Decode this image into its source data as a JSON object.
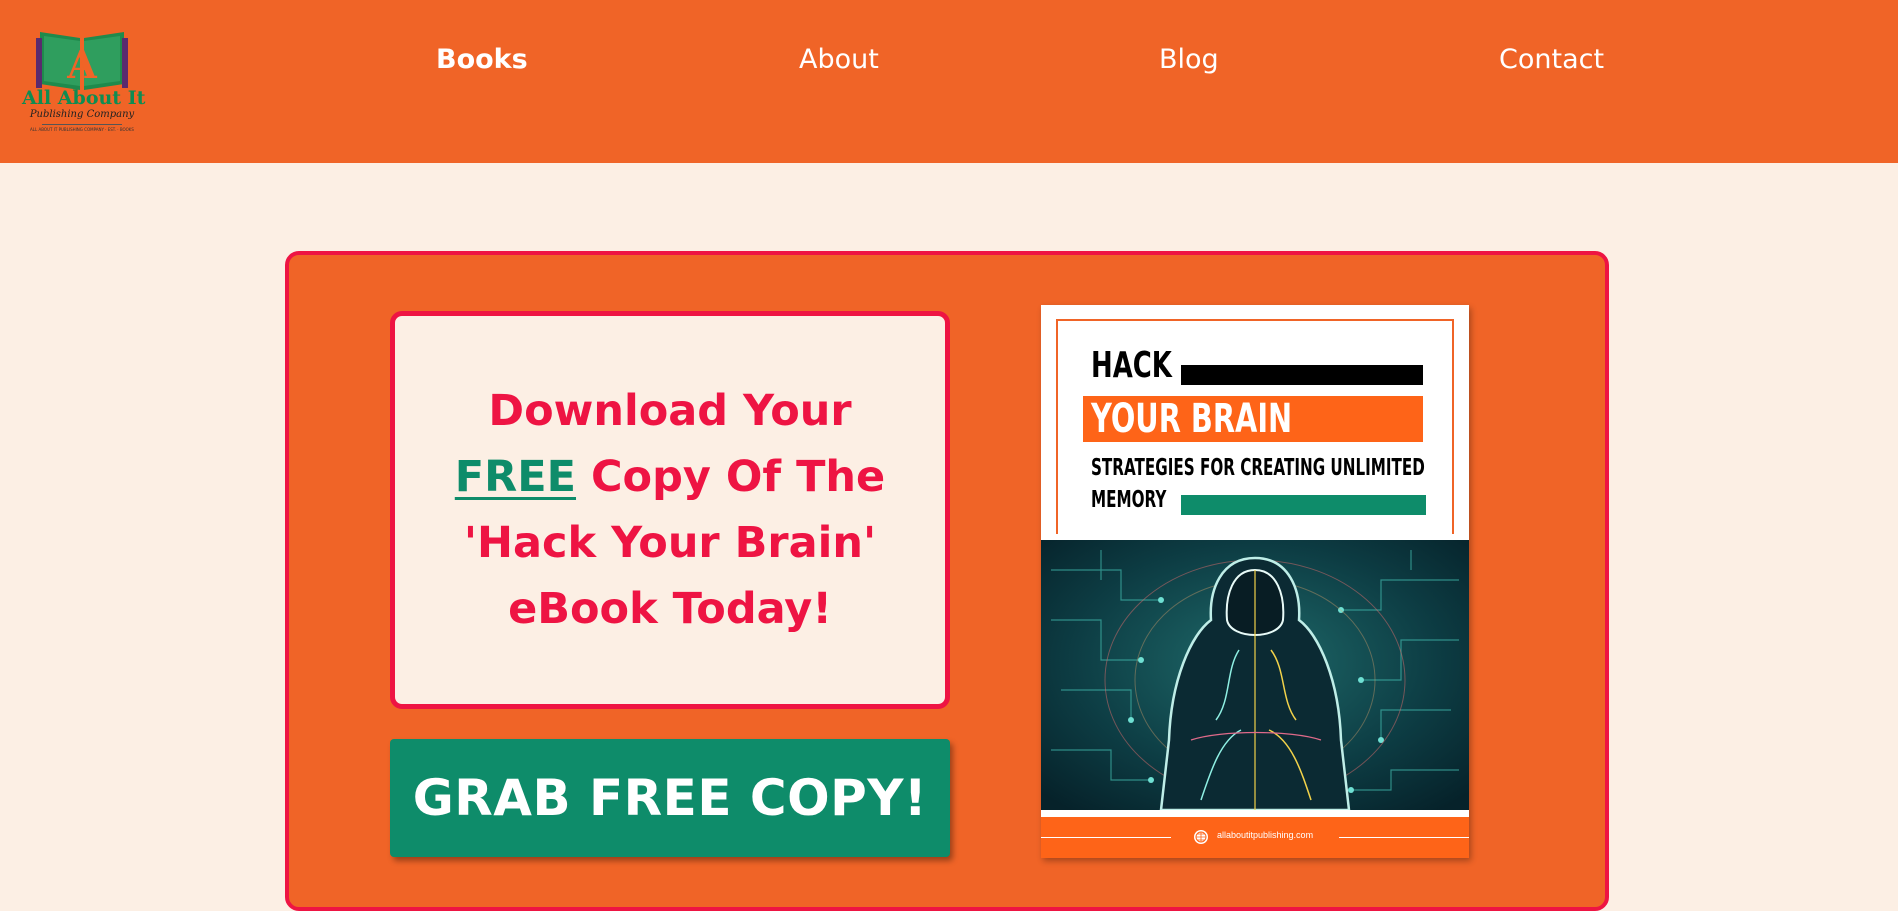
{
  "logo": {
    "name": "All About It",
    "tagline": "Publishing Company",
    "fine_print": "ALL ABOUT IT PUBLISHING COMPANY · EST. · BOOKS"
  },
  "nav": {
    "items": [
      {
        "label": "Books",
        "active": true
      },
      {
        "label": "About",
        "active": false
      },
      {
        "label": "Blog",
        "active": false
      },
      {
        "label": "Contact",
        "active": false
      }
    ]
  },
  "promo": {
    "headline_line1": "Download Your",
    "headline_free": "FREE",
    "headline_line2_rest": " Copy Of The",
    "headline_line3": "'Hack Your Brain'",
    "headline_line4": "eBook Today!",
    "cta_label": "GRAB FREE COPY!"
  },
  "book_cover": {
    "title_line1": "HACK",
    "title_line2": "YOUR BRAIN",
    "subtitle_line1": "STRATEGIES FOR CREATING UNLIMITED",
    "subtitle_line2": "MEMORY",
    "website": "allaboutitpublishing.com"
  },
  "colors": {
    "header_orange": "#f06427",
    "page_bg": "#fcefe4",
    "accent_red": "#ee1443",
    "accent_green": "#0e8c6a",
    "cover_orange": "#fe6418"
  }
}
